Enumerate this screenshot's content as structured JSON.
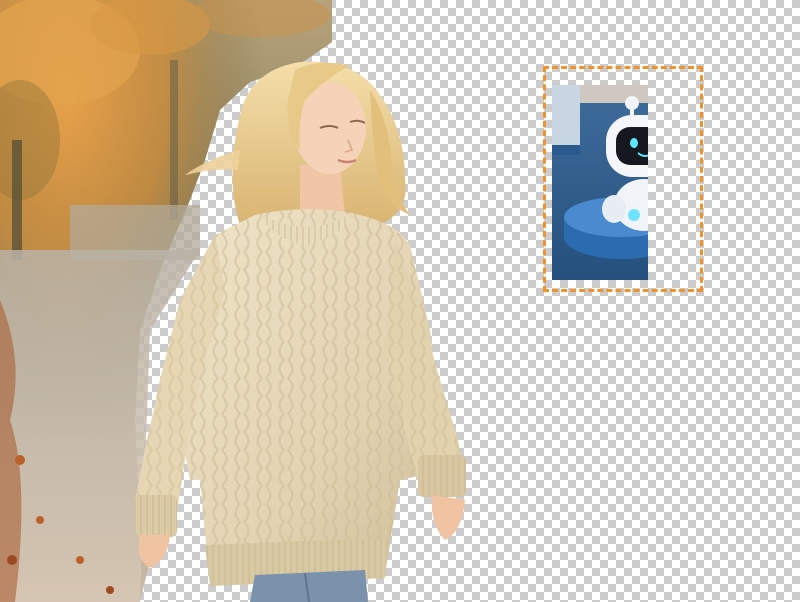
{
  "canvas": {
    "background": "transparency-checkerboard",
    "checker_colors": [
      "#ffffff",
      "#cccccc"
    ]
  },
  "subject": {
    "description_icon": "woman-walking-photo",
    "sweater_color": "#e9dcc0",
    "hair_color": "#e8c98a"
  },
  "selection": {
    "icon": "robot-mascot",
    "border_color": "#f0932b",
    "style": "dashed"
  }
}
